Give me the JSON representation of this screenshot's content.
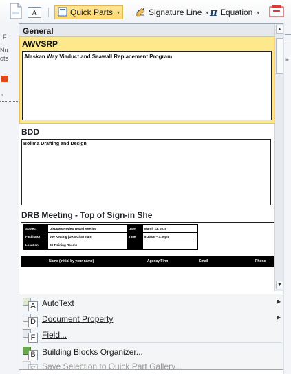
{
  "ribbon": {
    "quick_parts_label": "Quick Parts",
    "signature_label": "Signature Line",
    "equation_label": "Equation",
    "equation_symbol": "π",
    "textbox_glyph": "A"
  },
  "left_strip": [
    "F",
    "Nu",
    "ote"
  ],
  "gallery": {
    "header": "General",
    "blocks": [
      {
        "name": "AWVSRP",
        "preview_text": "Alaskan Way Viaduct and Seawall Replacement Program"
      },
      {
        "name": "BDD",
        "preview_text": "Bolima Drafting and Design"
      },
      {
        "name": "DRB Meeting - Top of Sign-in She",
        "preview_text": ""
      }
    ],
    "drb_table": {
      "rows": [
        [
          "Subject",
          "Disputes Review Board Meeting",
          "Date",
          "March 13, 2015"
        ],
        [
          "Facilitator",
          "Joe Keating (DRB Chairman)",
          "Time",
          "8:30am – 3:30pm"
        ],
        [
          "Location",
          "23 Training Rooms",
          "",
          ""
        ]
      ],
      "header_cols": [
        "Name (initial by your name)",
        "Agency/Firm",
        "Email",
        "Phone"
      ]
    }
  },
  "menu": {
    "items": [
      {
        "label": "AutoText",
        "key": "A",
        "submenu": true,
        "enabled": true
      },
      {
        "label": "Document Property",
        "key": "D",
        "submenu": true,
        "enabled": true
      },
      {
        "label": "Field...",
        "key": "F",
        "submenu": false,
        "enabled": true
      },
      {
        "label": "Building Blocks Organizer...",
        "key": "B",
        "submenu": false,
        "enabled": true
      },
      {
        "label": "Save Selection to Quick Part Gallery...",
        "key": "S",
        "submenu": false,
        "enabled": false
      }
    ]
  },
  "colors": {
    "selected_fill": "#fde88c",
    "selected_border": "#f2c04f",
    "menu_bg": "#f4f5f7",
    "accent_blue": "#2b579a"
  },
  "icons": [
    "page-icon",
    "textbox-icon",
    "quick-parts-icon",
    "signature-line-icon",
    "equation-icon",
    "object-icon",
    "autotext-icon",
    "document-property-icon",
    "field-icon",
    "building-blocks-icon",
    "save-selection-icon"
  ]
}
